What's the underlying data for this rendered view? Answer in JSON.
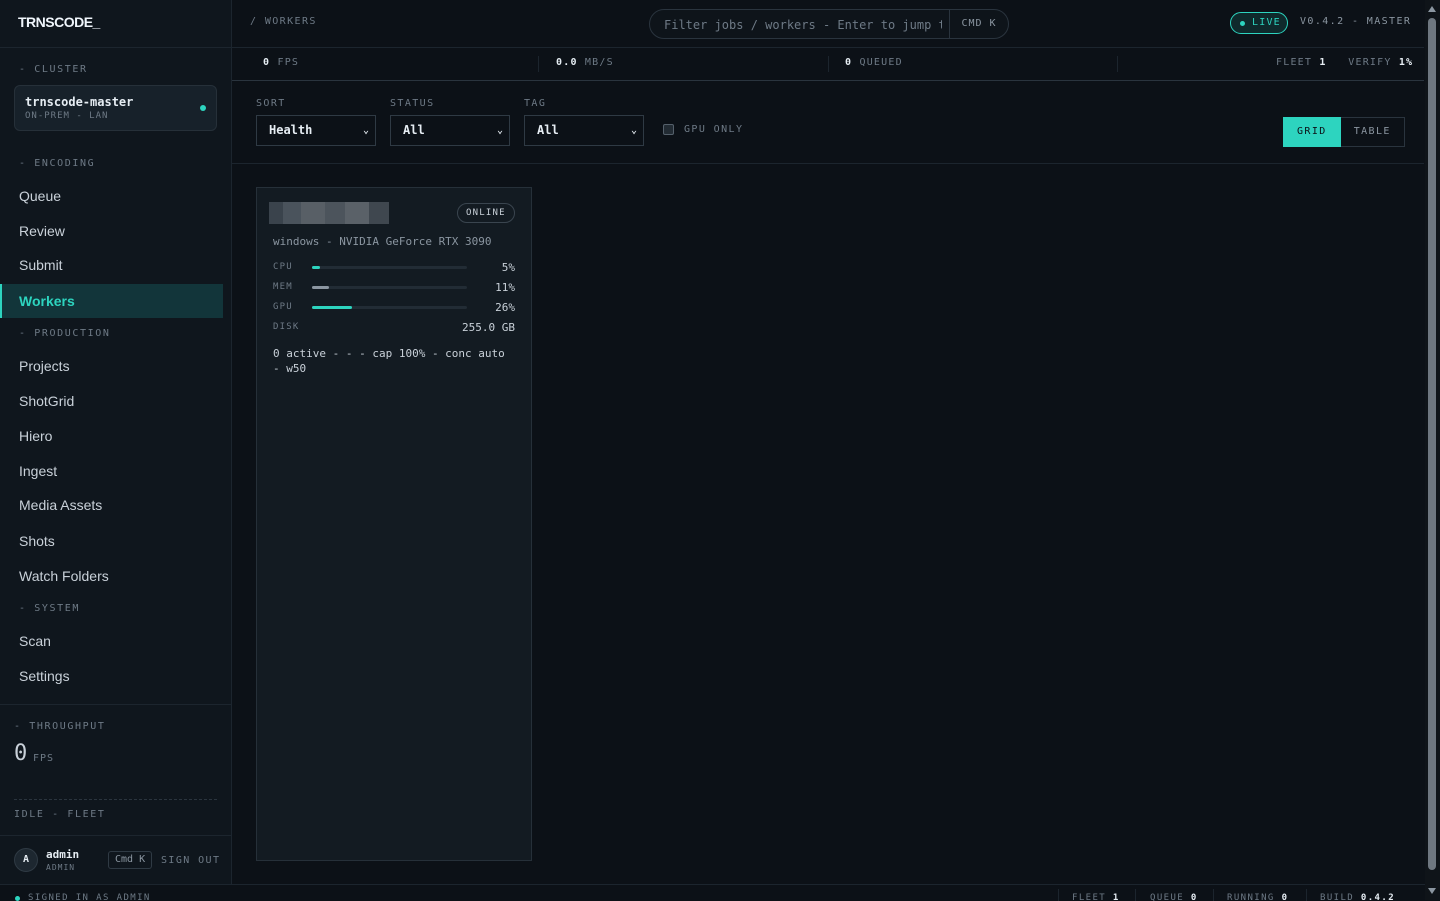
{
  "brand": "TRNSCODE_",
  "sidebar": {
    "cluster_label": "- CLUSTER",
    "cluster": {
      "name": "trnscode-master",
      "sub": "ON-PREM - LAN"
    },
    "sections": {
      "encoding": "- ENCODING",
      "production": "- PRODUCTION",
      "system": "- SYSTEM"
    },
    "encoding_items": [
      "Queue",
      "Review",
      "Submit",
      "Workers"
    ],
    "production_items": [
      "Projects",
      "ShotGrid",
      "Hiero",
      "Ingest",
      "Media Assets",
      "Shots",
      "Watch Folders"
    ],
    "system_items": [
      "Scan",
      "Settings"
    ],
    "active_item": "Workers",
    "throughput": {
      "label": "- THROUGHPUT",
      "value": "0",
      "unit": "FPS"
    },
    "idle": "IDLE - FLEET",
    "user": {
      "initial": "A",
      "name": "admin",
      "role": "ADMIN",
      "shortcut": "Cmd K",
      "signout": "SIGN OUT"
    }
  },
  "topbar": {
    "breadcrumb": "/ WORKERS",
    "search_placeholder": "Filter jobs / workers - Enter to jump to first",
    "search_shortcut": "CMD K",
    "live": "LIVE",
    "version": "V0.4.2 - MASTER"
  },
  "stats": {
    "fps_value": "0",
    "fps_unit": "FPS",
    "mbs_value": "0.0",
    "mbs_unit": "MB/S",
    "queued_value": "0",
    "queued_unit": "QUEUED",
    "fleet_label": "FLEET",
    "fleet_value": "1",
    "verify_label": "VERIFY",
    "verify_value": "1%"
  },
  "filters": {
    "sort_label": "SORT",
    "sort_value": "Health",
    "status_label": "STATUS",
    "status_value": "All",
    "tag_label": "TAG",
    "tag_value": "All",
    "gpu_only": "GPU ONLY",
    "view_grid": "GRID",
    "view_table": "TABLE",
    "active_view": "GRID"
  },
  "worker": {
    "status": "ONLINE",
    "system": "windows - NVIDIA GeForce RTX 3090",
    "metrics": {
      "cpu_label": "CPU",
      "cpu_value": "5%",
      "cpu_fraction": 0.05,
      "mem_label": "MEM",
      "mem_value": "11%",
      "mem_fraction": 0.11,
      "gpu_label": "GPU",
      "gpu_value": "26%",
      "gpu_fraction": 0.26,
      "disk_label": "DISK",
      "disk_value": "255.0 GB"
    },
    "summary": "0 active - - - cap 100% - conc auto - w50"
  },
  "footer": {
    "signed_in": "SIGNED IN AS ADMIN",
    "fleet_label": "FLEET",
    "fleet_value": "1",
    "queue_label": "QUEUE",
    "queue_value": "0",
    "running_label": "RUNNING",
    "running_value": "0",
    "build_label": "BUILD",
    "build_value": "0.4.2"
  },
  "colors": {
    "accent": "#2dd4bf",
    "mem_bar": "#8b96a1",
    "background": "#0c1117"
  },
  "icons": {
    "cluster_status": "status-dot-icon",
    "select": "chevron-down-icon",
    "live": "live-dot-icon"
  }
}
